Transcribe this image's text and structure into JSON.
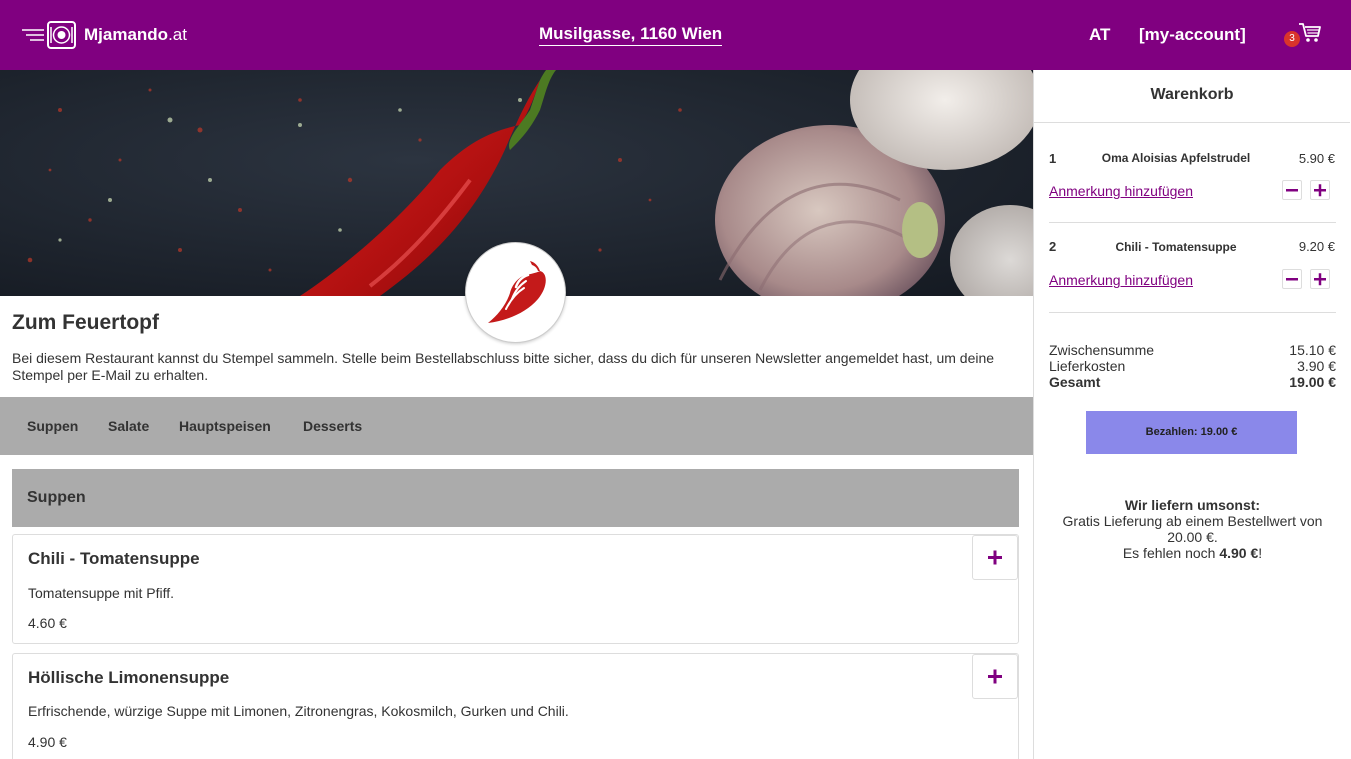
{
  "header": {
    "brand_name": "Mjamando",
    "brand_tld": ".at",
    "address": "Musilgasse, 1160 Wien",
    "language": "AT",
    "account": "[my-account]",
    "cart_count": "3",
    "background": "#800080"
  },
  "restaurant": {
    "name": "Zum Feuertopf",
    "description": "Bei diesem Restaurant kannst du Stempel sammeln. Stelle beim Bestellabschluss bitte sicher, dass du dich für unseren Newsletter angemeldet hast, um deine Stempel per E-Mail zu erhalten."
  },
  "categories": [
    "Suppen",
    "Salate",
    "Hauptspeisen",
    "Desserts"
  ],
  "menu_section": {
    "title": "Suppen",
    "items": [
      {
        "name": "Chili - Tomatensuppe",
        "description": "Tomatensuppe mit Pfiff.",
        "price": "4.60 €"
      },
      {
        "name": "Höllische Limonensuppe",
        "description": "Erfrischende, würzige Suppe mit Limonen, Zitronengras, Kokosmilch, Gurken und Chili.",
        "price": "4.90 €"
      }
    ]
  },
  "cart": {
    "title": "Warenkorb",
    "items": [
      {
        "qty": "1",
        "name": "Oma Aloisias Apfelstrudel",
        "price": "5.90 €",
        "note_link": "Anmerkung hinzufügen"
      },
      {
        "qty": "2",
        "name": "Chili - Tomatensuppe",
        "price": "9.20 €",
        "note_link": "Anmerkung hinzufügen"
      }
    ],
    "subtotal_label": "Zwischensumme",
    "subtotal": "15.10 €",
    "delivery_label": "Lieferkosten",
    "delivery": "3.90 €",
    "total_label": "Gesamt",
    "total": "19.00 €",
    "pay_button": "Bezahlen: 19.00 €",
    "free_title": "Wir liefern umsonst:",
    "free_text": "Gratis Lieferung ab einem Bestellwert von 20.00 €.",
    "missing_prefix": "Es fehlen noch",
    "missing_amount": "4.90 €",
    "missing_suffix": "!"
  },
  "colors": {
    "brand": "#800080",
    "pay_button": "#8a88ea",
    "badge": "#d9342b",
    "chili": "#c41a1a"
  }
}
